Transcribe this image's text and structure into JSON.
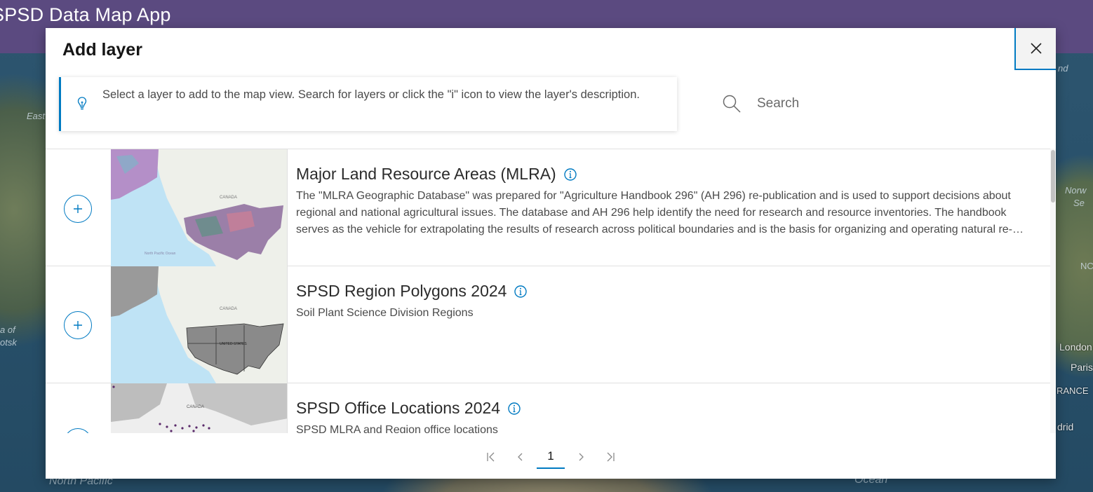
{
  "app": {
    "title": "SPSD Data Map App"
  },
  "map": {
    "labels": [
      "East",
      "Norw",
      "Se",
      "NC",
      "a of",
      "otsk",
      "London",
      "Paris",
      "RANCE",
      "drid",
      "North Pacific",
      "Ocean",
      "nd"
    ]
  },
  "modal": {
    "title": "Add layer",
    "close_icon": "close-icon",
    "notice": {
      "icon": "lightbulb-icon",
      "text": "Select a layer to add to the map view. Search for layers or click the \"i\" icon to view the layer's description."
    },
    "search": {
      "icon": "search-icon",
      "placeholder": "Search"
    },
    "layers": [
      {
        "title": "Major Land Resource Areas (MLRA)",
        "description": "The \"MLRA Geographic Database\" was prepared for \"Agriculture Handbook 296\" (AH 296) re-publication and is used to support decisions about regional and national agricultural issues. The database and AH 296 help identify the need for research and resource inventories. The handbook serves as the vehicle for extrapolating the results of research across political boundaries and is the basis for organizing and operating natural re-source programs."
      },
      {
        "title": "SPSD Region Polygons 2024",
        "description": "Soil Plant Science Division Regions"
      },
      {
        "title": "SPSD Office Locations 2024",
        "description": "SPSD MLRA and Region office locations"
      }
    ],
    "thumbnail_labels": {
      "canada": "CANADA",
      "north_pacific_ocean": "North Pacific Ocean",
      "united_states": "UNITED STATES"
    },
    "pagination": {
      "current_page": "1",
      "first_icon": "first-page-icon",
      "prev_icon": "chevron-left-icon",
      "next_icon": "chevron-right-icon",
      "last_icon": "last-page-icon"
    }
  },
  "colors": {
    "header": "#5b4a80",
    "accent": "#007ac2"
  }
}
